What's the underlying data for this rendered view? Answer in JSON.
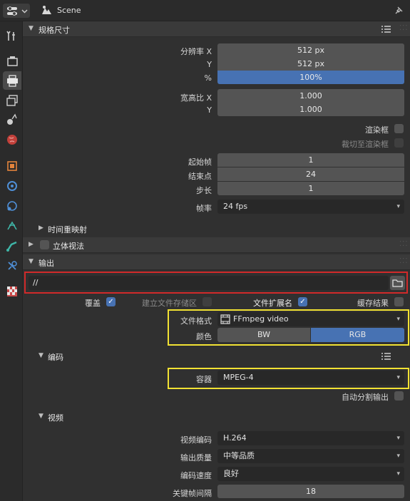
{
  "header": {
    "scene_label": "Scene"
  },
  "dimensions": {
    "title": "规格尺寸",
    "resolution_x_label": "分辨率 X",
    "resolution_x": "512 px",
    "resolution_y_label": "Y",
    "resolution_y": "512 px",
    "percent_label": "%",
    "percent": "100%",
    "aspect_x_label": "宽高比 X",
    "aspect_x": "1.000",
    "aspect_y_label": "Y",
    "aspect_y": "1.000",
    "render_region_label": "渲染框",
    "crop_label": "裁切至渲染框",
    "frame_start_label": "起始帧",
    "frame_start": "1",
    "frame_end_label": "结束点",
    "frame_end": "24",
    "frame_step_label": "步长",
    "frame_step": "1",
    "fps_label": "帧率",
    "fps": "24 fps",
    "time_remap_label": "时间重映射"
  },
  "stereo": {
    "title": "立体视法"
  },
  "output": {
    "title": "输出",
    "path": "//",
    "overwrite_label": "覆盖",
    "placeholders_label": "建立文件存储区",
    "file_ext_label": "文件扩展名",
    "cache_label": "缓存结果",
    "file_format_label": "文件格式",
    "file_format": "FFmpeg video",
    "color_label": "颜色",
    "color_bw": "BW",
    "color_rgb": "RGB"
  },
  "encoding": {
    "title": "编码",
    "container_label": "容器",
    "container": "MPEG-4",
    "autosplit_label": "自动分割输出"
  },
  "video": {
    "title": "视频",
    "codec_label": "视频编码",
    "codec": "H.264",
    "quality_label": "输出质量",
    "quality": "中等品质",
    "speed_label": "编码速度",
    "speed": "良好",
    "keyframe_label": "关键帧间隔",
    "keyframe": "18"
  },
  "colors": {
    "accent": "#4772b3",
    "highlight_red": "#d12a2a",
    "highlight_yellow": "#f2e233"
  }
}
